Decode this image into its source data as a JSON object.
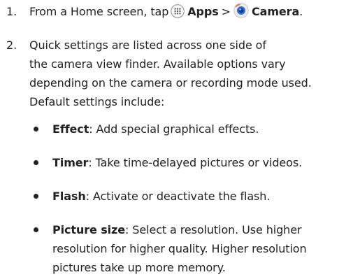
{
  "step1": {
    "number": "1.",
    "prefix": "From a Home screen, tap",
    "apps_label": "Apps",
    "separator": ">",
    "camera_label": "Camera",
    "suffix": "."
  },
  "step2": {
    "number": "2.",
    "lines": [
      "Quick settings are listed across one side of",
      "the camera view finder. Available options vary",
      "depending on the camera or recording mode used.",
      "Default settings include:"
    ]
  },
  "bullets": [
    {
      "term": "Effect",
      "lines": [
        ": Add special graphical effects."
      ]
    },
    {
      "term": "Timer",
      "lines": [
        ": Take time-delayed pictures or videos."
      ]
    },
    {
      "term": "Flash",
      "lines": [
        ": Activate or deactivate the flash."
      ]
    },
    {
      "term": "Picture size",
      "lines": [
        ": Select a resolution. Use higher",
        "resolution for higher quality. Higher resolution",
        "pictures take up more memory."
      ]
    }
  ],
  "icons": {
    "apps": "apps-grid-icon",
    "camera": "camera-app-icon"
  },
  "colors": {
    "text": "#222222",
    "camera_icon_blue": "#2f6fd6"
  }
}
